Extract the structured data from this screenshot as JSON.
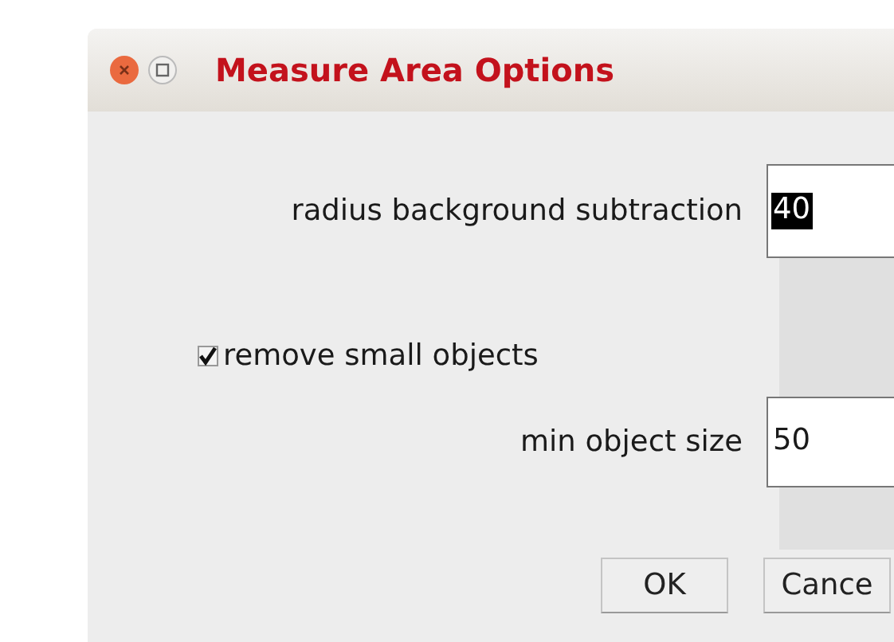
{
  "window": {
    "title": "Measure Area Options"
  },
  "fields": [
    {
      "label": "radius background subtraction",
      "value": "40",
      "value_selected": true
    },
    {
      "kind": "checkbox",
      "label": "remove small objects",
      "checked": true
    },
    {
      "label": "min object size",
      "value": "50",
      "value_selected": false
    }
  ],
  "buttons": [
    "OK",
    "Cance"
  ]
}
